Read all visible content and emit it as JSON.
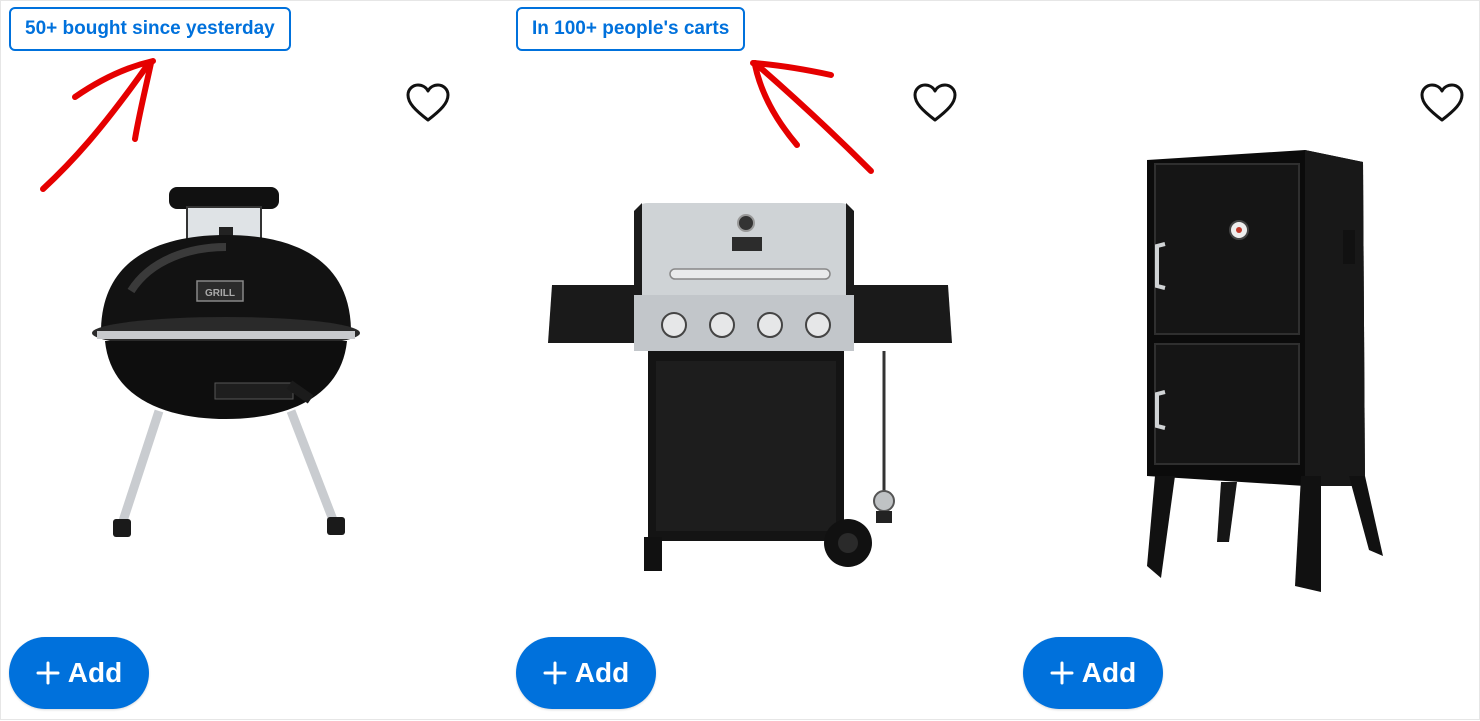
{
  "colors": {
    "accent": "#0071dc",
    "annotation": "#e50000"
  },
  "cards": [
    {
      "badge": "50+ bought since yesterday",
      "favorite_icon": "heart-outline-icon",
      "image": "tabletop-kettle-charcoal-grill",
      "add_icon": "plus-icon",
      "add_label": "Add"
    },
    {
      "badge": "In 100+ people's carts",
      "favorite_icon": "heart-outline-icon",
      "image": "four-burner-gas-grill",
      "add_icon": "plus-icon",
      "add_label": "Add"
    },
    {
      "badge": "",
      "favorite_icon": "heart-outline-icon",
      "image": "vertical-charcoal-smoker",
      "add_icon": "plus-icon",
      "add_label": "Add"
    }
  ],
  "annotations": [
    {
      "icon": "hand-drawn-arrow-icon",
      "points_to": "card-1-badge"
    },
    {
      "icon": "hand-drawn-arrow-icon",
      "points_to": "card-2-badge"
    }
  ]
}
